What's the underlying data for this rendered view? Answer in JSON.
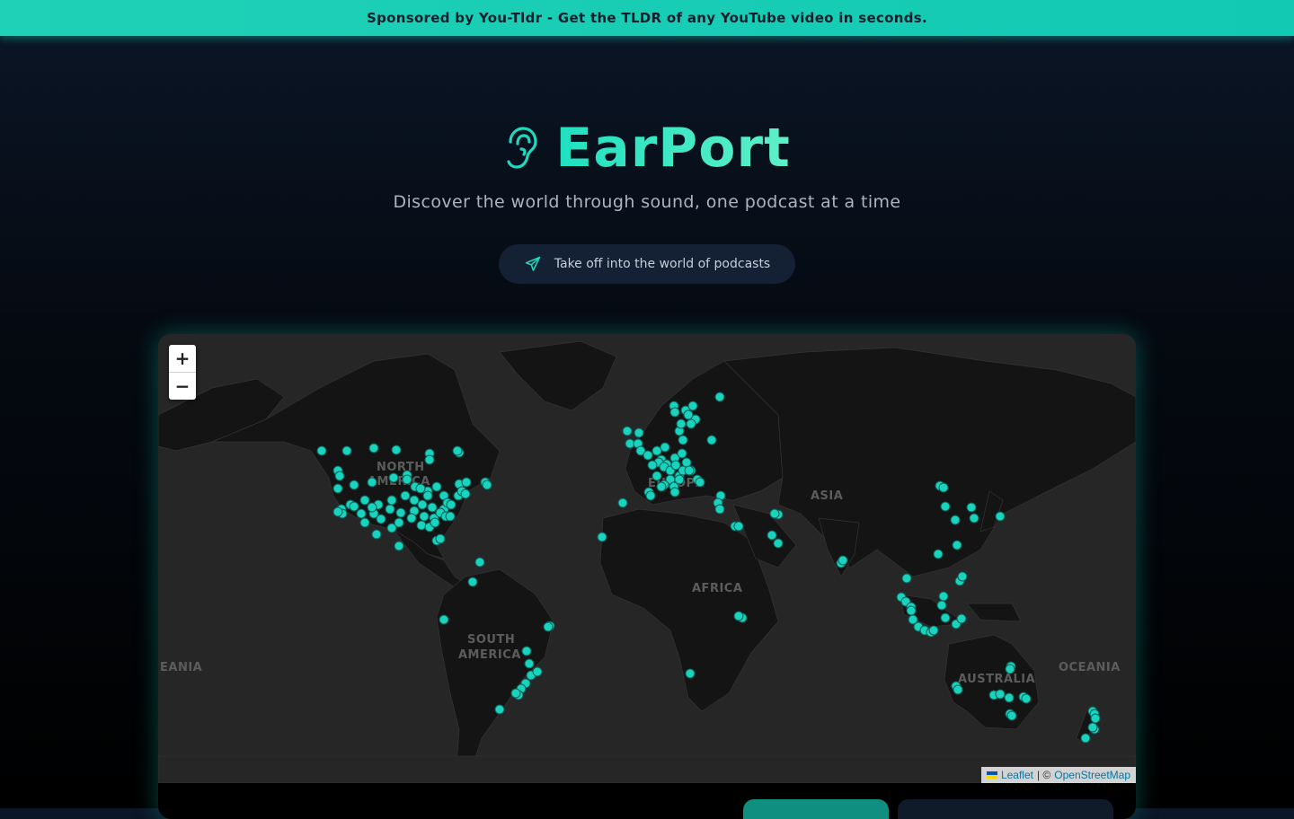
{
  "banner": {
    "text": "Sponsored by You-Tldr - Get the TLDR of any YouTube video in seconds."
  },
  "hero": {
    "title": "EarPort",
    "tagline": "Discover the world through sound, one podcast at a time",
    "cta_label": "Take off into the world of podcasts",
    "logo_icon": "ear-icon",
    "cta_icon": "plane-icon"
  },
  "map": {
    "zoom_in": "+",
    "zoom_out": "−",
    "attribution": {
      "leaflet": "Leaflet",
      "separator": "| ©",
      "osm": "OpenStreetMap"
    },
    "continent_labels": {
      "north_america": [
        "NORTH",
        "AMERICA"
      ],
      "south_america": [
        "SOUTH",
        "AMERICA"
      ],
      "europe": "EUROPE",
      "africa": "AFRICA",
      "asia": "ASIA",
      "australia": "AUSTRALIA",
      "oceania_right": "OCEANIA",
      "oceania_left": "EANIA"
    },
    "marker_color": "#19d3be",
    "land_color": "#141414",
    "water_color": "#262626"
  }
}
